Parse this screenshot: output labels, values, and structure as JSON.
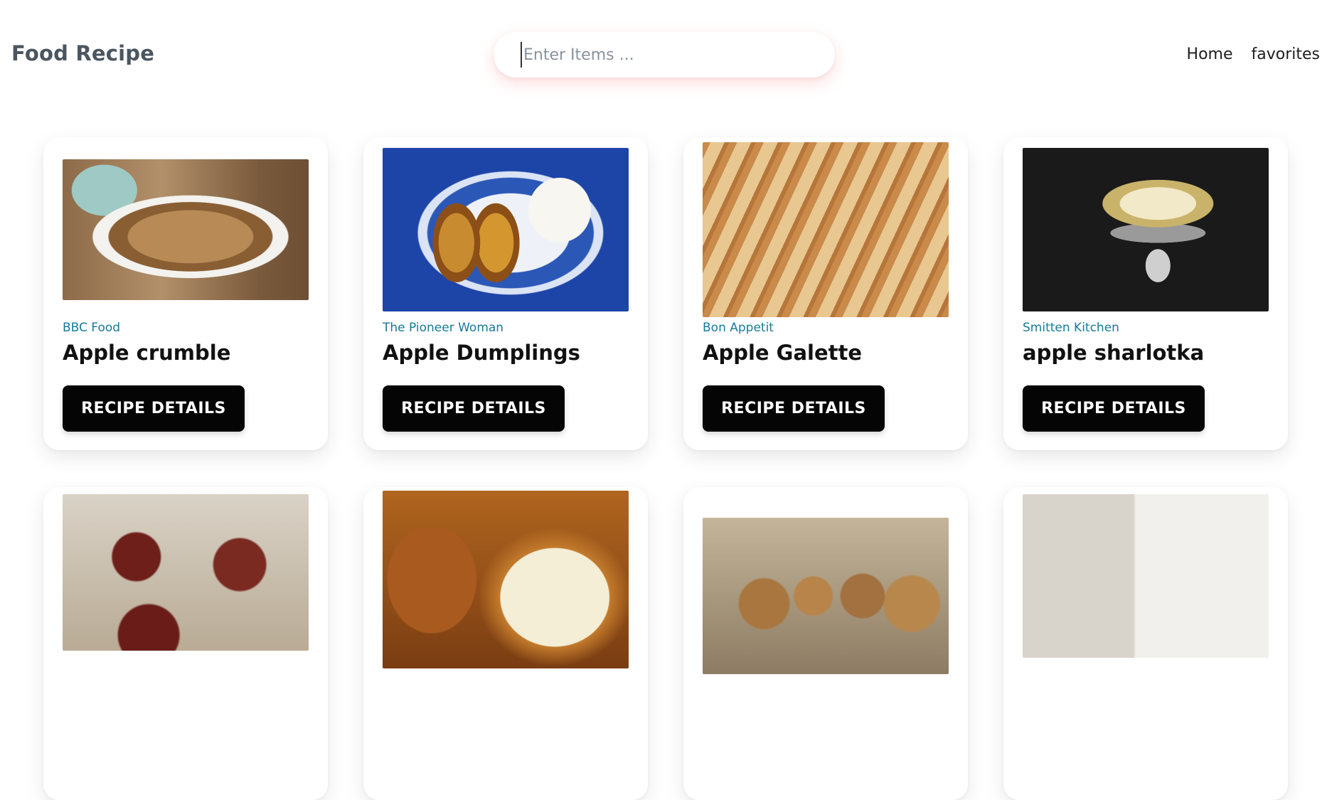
{
  "header": {
    "brand": "Food Recipe",
    "search": {
      "placeholder": "Enter Items ...",
      "value": ""
    },
    "nav": [
      {
        "label": "Home"
      },
      {
        "label": "favorites"
      }
    ]
  },
  "recipes": [
    {
      "publisher": "BBC Food",
      "title": "Apple crumble",
      "button": "RECIPE DETAILS"
    },
    {
      "publisher": "The Pioneer Woman",
      "title": "Apple Dumplings",
      "button": "RECIPE DETAILS"
    },
    {
      "publisher": "Bon Appetit",
      "title": "Apple Galette",
      "button": "RECIPE DETAILS"
    },
    {
      "publisher": "Smitten Kitchen",
      "title": "apple sharlotka",
      "button": "RECIPE DETAILS"
    }
  ]
}
